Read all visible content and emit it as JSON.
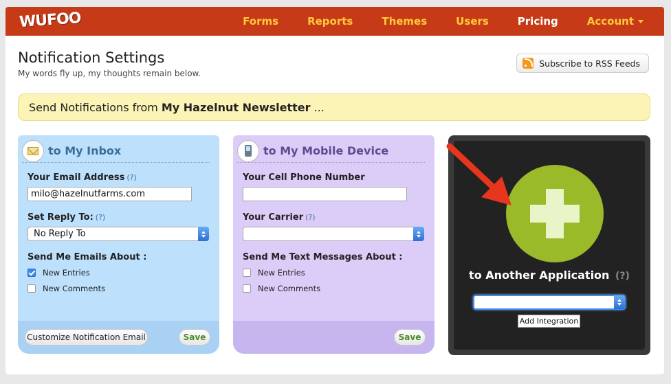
{
  "header": {
    "logo": "WUFOO",
    "nav": [
      {
        "label": "Forms"
      },
      {
        "label": "Reports"
      },
      {
        "label": "Themes"
      },
      {
        "label": "Users"
      },
      {
        "label": "Pricing"
      },
      {
        "label": "Account"
      }
    ],
    "active_nav": "Pricing"
  },
  "page": {
    "title": "Notification Settings",
    "subtitle": "My words fly up, my thoughts remain below.",
    "rss_button": "Subscribe to RSS Feeds",
    "notice_prefix": "Send Notifications from",
    "notice_form": "My Hazelnut Newsletter",
    "notice_suffix": "..."
  },
  "inbox": {
    "title": "to My Inbox",
    "email_label": "Your Email Address",
    "email_help": "(?)",
    "email_value": "milo@hazelnutfarms.com",
    "reply_label": "Set Reply To:",
    "reply_help": "(?)",
    "reply_value": "No Reply To",
    "about_label": "Send Me Emails About :",
    "options": [
      {
        "label": "New Entries",
        "checked": true
      },
      {
        "label": "New Comments",
        "checked": false
      }
    ],
    "customize_button": "Customize Notification Email",
    "save_button": "Save"
  },
  "mobile": {
    "title": "to My Mobile Device",
    "phone_label": "Your Cell Phone Number",
    "phone_value": "",
    "carrier_label": "Your Carrier",
    "carrier_help": "(?)",
    "carrier_value": "",
    "about_label": "Send Me Text Messages About :",
    "options": [
      {
        "label": "New Entries",
        "checked": false
      },
      {
        "label": "New Comments",
        "checked": false
      }
    ],
    "save_button": "Save"
  },
  "integration": {
    "title": "to Another Application",
    "help": "(?)",
    "select_value": "",
    "add_button": "Add Integration"
  },
  "colors": {
    "header_bg": "#c73a17",
    "nav_text": "#ffc93a",
    "notice_bg": "#fcf3b6",
    "inbox_bg": "#bde0fc",
    "mobile_bg": "#dcccf8",
    "integration_bg": "#222222",
    "plus_circle": "#9bba2a",
    "arrow": "#e8351d"
  }
}
